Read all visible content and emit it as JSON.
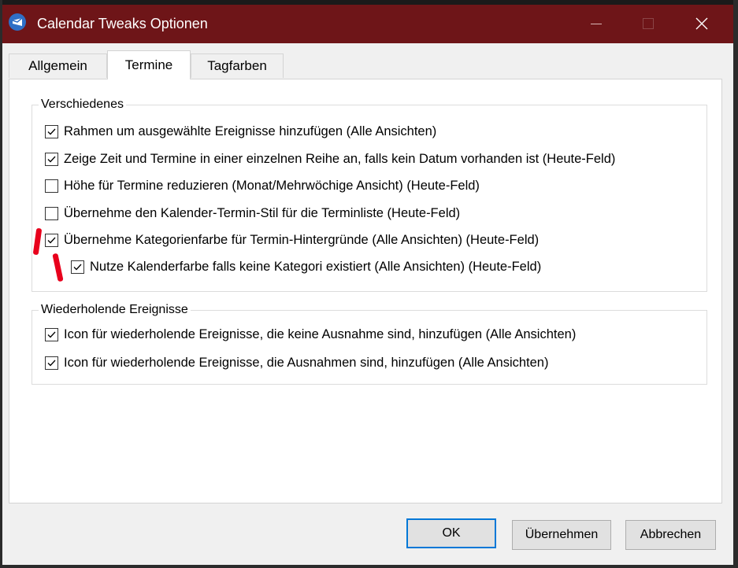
{
  "window": {
    "title": "Calendar Tweaks Optionen"
  },
  "tabs": [
    {
      "label": "Allgemein",
      "active": false
    },
    {
      "label": "Termine",
      "active": true
    },
    {
      "label": "Tagfarben",
      "active": false
    }
  ],
  "groups": {
    "misc": {
      "legend": "Verschiedenes",
      "options": [
        {
          "label": "Rahmen um ausgewählte Ereignisse hinzufügen (Alle Ansichten)",
          "checked": true
        },
        {
          "label": "Zeige Zeit und Termine in einer einzelnen Reihe an, falls kein Datum vorhanden ist (Heute-Feld)",
          "checked": true
        },
        {
          "label": "Höhe für Termine reduzieren (Monat/Mehrwöchige Ansicht) (Heute-Feld)",
          "checked": false
        },
        {
          "label": "Übernehme den Kalender-Termin-Stil für die Terminliste (Heute-Feld)",
          "checked": false
        },
        {
          "label": "Übernehme Kategorienfarbe für Termin-Hintergründe (Alle Ansichten) (Heute-Feld)",
          "checked": true
        },
        {
          "label": "Nutze Kalenderfarbe falls keine Kategori existiert (Alle Ansichten) (Heute-Feld)",
          "checked": true
        }
      ]
    },
    "recurring": {
      "legend": "Wiederholende Ereignisse",
      "options": [
        {
          "label": "Icon für wiederholende Ereignisse, die keine Ausnahme sind, hinzufügen (Alle Ansichten)",
          "checked": true
        },
        {
          "label": "Icon für wiederholende Ereignisse, die Ausnahmen sind, hinzufügen (Alle Ansichten)",
          "checked": true
        }
      ]
    }
  },
  "buttons": {
    "ok": "OK",
    "apply": "Übernehmen",
    "cancel": "Abbrechen"
  },
  "colors": {
    "titlebar": "#6e1518",
    "accent": "#0078d7",
    "annotation": "#e8001c"
  }
}
